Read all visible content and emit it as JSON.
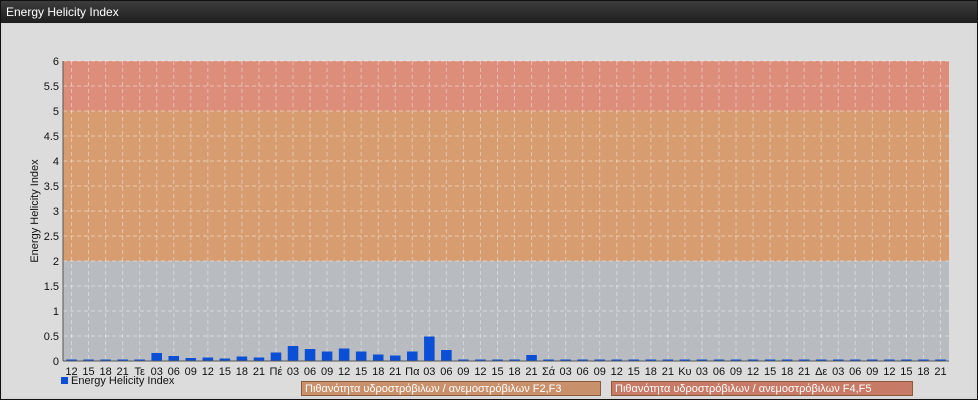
{
  "window": {
    "title": "Energy Helicity Index"
  },
  "chart_data": {
    "type": "bar",
    "title": "",
    "ylabel": "Energy Helicity Index",
    "xlabel": "",
    "ylim": [
      0,
      6
    ],
    "yticks": [
      "0",
      "0.5",
      "1",
      "1.5",
      "2",
      "2.5",
      "3",
      "3.5",
      "4",
      "4.5",
      "5",
      "5.5",
      "6"
    ],
    "grid": true,
    "categories": [
      "12",
      "15",
      "18",
      "21",
      "Τε",
      "03",
      "06",
      "09",
      "12",
      "15",
      "18",
      "21",
      "Πέ",
      "03",
      "06",
      "09",
      "12",
      "15",
      "18",
      "21",
      "Πα",
      "03",
      "06",
      "09",
      "12",
      "15",
      "18",
      "21",
      "Σά",
      "03",
      "06",
      "09",
      "12",
      "15",
      "18",
      "21",
      "Κυ",
      "03",
      "06",
      "09",
      "12",
      "15",
      "18",
      "21",
      "Δε",
      "03",
      "06",
      "09",
      "12",
      "15",
      "18",
      "21"
    ],
    "series": [
      {
        "name": "Energy Helicity Index",
        "color": "#0a4fd6",
        "values": [
          0.01,
          0.01,
          0.01,
          0.01,
          0.02,
          0.16,
          0.1,
          0.06,
          0.07,
          0.05,
          0.09,
          0.07,
          0.17,
          0.3,
          0.24,
          0.19,
          0.25,
          0.19,
          0.13,
          0.11,
          0.19,
          0.49,
          0.22,
          0.03,
          0.01,
          0.01,
          0.01,
          0.12,
          0.01,
          0.01,
          0.01,
          0.01,
          0.01,
          0.01,
          0.01,
          0.01,
          0.01,
          0.01,
          0.01,
          0.01,
          0.01,
          0.01,
          0.01,
          0.01,
          0.01,
          0.03,
          0.01,
          0.01,
          0.01,
          0.01,
          0.01,
          0.01
        ]
      }
    ],
    "bands": [
      {
        "from": 2,
        "to": 5,
        "color": "#d99a6a",
        "label": "Πιθανότητα υδροστρόβιλων / ανεμοστρόβιλων F2,F3"
      },
      {
        "from": 5,
        "to": 6,
        "color": "#e08a74",
        "label": "Πιθανότητα υδροστρόβιλων / ανεμοστρόβιλων F4,F5"
      }
    ],
    "legend": {
      "position": "bottom-left"
    }
  }
}
